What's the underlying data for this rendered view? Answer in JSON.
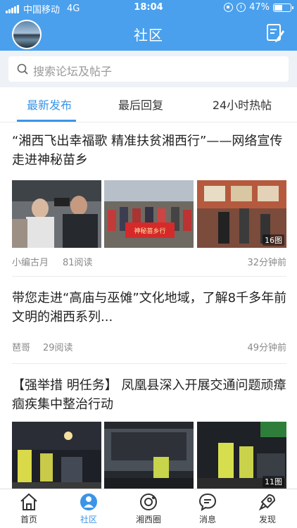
{
  "status_bar": {
    "carrier": "中国移动",
    "network": "4G",
    "time": "18:04",
    "battery": "47%",
    "battery_level": 0.47
  },
  "header": {
    "title": "社区"
  },
  "search": {
    "placeholder": "搜索论坛及帖子"
  },
  "tabs": [
    {
      "label": "最新发布",
      "active": true
    },
    {
      "label": "最后回复",
      "active": false
    },
    {
      "label": "24小时热帖",
      "active": false
    }
  ],
  "posts": [
    {
      "title": "“湘西飞出幸福歌 精准扶贫湘西行”——网络宣传走进神秘苗乡",
      "banner_text": "神秘苗乡行",
      "image_count": "16图",
      "author": "小编古月",
      "reads": "81阅读",
      "time": "32分钟前"
    },
    {
      "title": "带您走进“高庙与巫傩”文化地域，了解8千多年前文明的湘西系列...",
      "author": "琶哥",
      "reads": "29阅读",
      "time": "49分钟前"
    },
    {
      "title": "【强举措 明任务】 凤凰县深入开展交通问题顽瘴痼疾集中整治行动",
      "image_count": "11图"
    }
  ],
  "bottom_nav": [
    {
      "label": "首页",
      "icon": "home-icon",
      "active": false
    },
    {
      "label": "社区",
      "icon": "community-icon",
      "active": true
    },
    {
      "label": "湘西圈",
      "icon": "circle-icon",
      "active": false
    },
    {
      "label": "消息",
      "icon": "message-icon",
      "active": false
    },
    {
      "label": "发现",
      "icon": "rocket-icon",
      "active": false
    }
  ],
  "colors": {
    "accent": "#3a95e8",
    "header_bg": "#4aa0ec"
  }
}
